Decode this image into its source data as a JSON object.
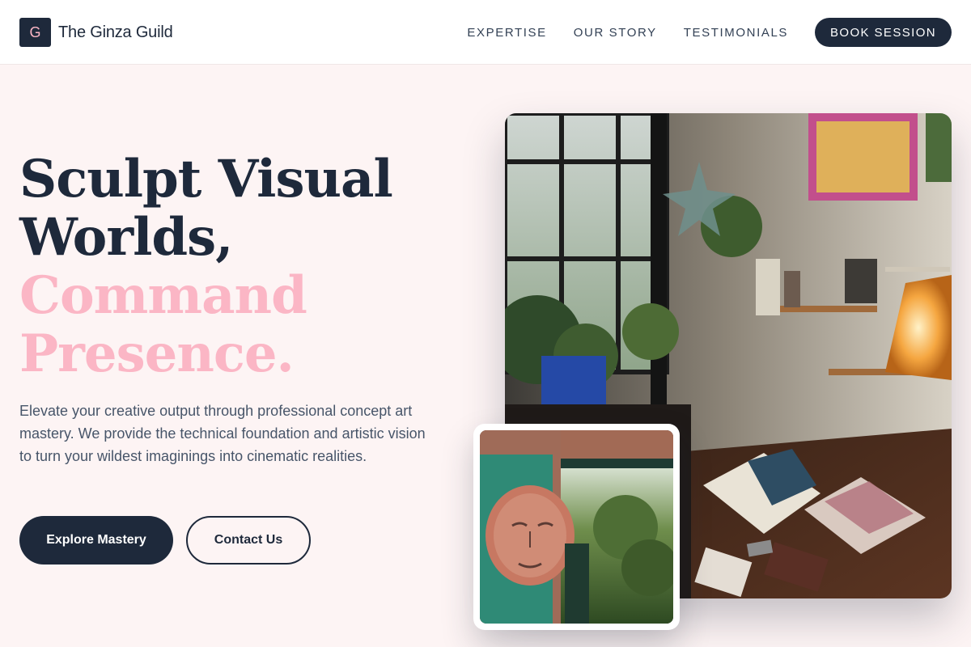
{
  "brand": {
    "logo_letter": "G",
    "name": "The Ginza Guild"
  },
  "nav": {
    "links": [
      "EXPERTISE",
      "OUR STORY",
      "TESTIMONIALS"
    ],
    "cta": "BOOK SESSION"
  },
  "hero": {
    "headline_dark": [
      "Sculpt Visual",
      "Worlds,"
    ],
    "headline_accent": [
      "Command",
      "Presence."
    ],
    "lead": "Elevate your creative output through professional concept art mastery. We provide the technical foundation and artistic vision to turn your wildest imaginings into cinematic realities.",
    "primary_button": "Explore Mastery",
    "secondary_button": "Contact Us"
  },
  "images": {
    "main": "art-studio-photo",
    "inset": "mural-face-photo"
  },
  "colors": {
    "navy": "#1e293b",
    "accent_pink": "#fbb6c5",
    "background": "#fdf4f4"
  }
}
